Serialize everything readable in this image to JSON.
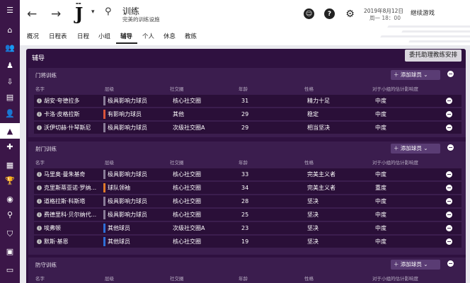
{
  "header": {
    "title": "训练",
    "subtitle": "完美的训练设施",
    "date": "2019年8月12日",
    "day_time": "周一 18：00",
    "continue_label": "继续游戏"
  },
  "tabs": [
    "概况",
    "日程表",
    "日程",
    "小组",
    "辅导",
    "个人",
    "休息",
    "教练"
  ],
  "panel": {
    "title": "辅导",
    "delegate_label": "委托助理教练安排"
  },
  "columns": [
    "名字",
    "层级",
    "社交圈",
    "年龄",
    "性格",
    "对于小组的估计影响度"
  ],
  "add_label": "添加球员",
  "sections": [
    {
      "title": "门将训练",
      "rows": [
        {
          "name": "胡安·夸德拉多",
          "level": "极具影响力球员",
          "level_color": "#8a7d99",
          "circle": "核心社交圈",
          "age": "31",
          "personality": "精力十足",
          "impact": "中度"
        },
        {
          "name": "卡洛·皮格拉斯",
          "level": "有影响力球员",
          "level_color": "#d9533b",
          "circle": "其他",
          "age": "29",
          "personality": "稳定",
          "impact": "中度"
        },
        {
          "name": "沃伊切赫·什琴斯尼",
          "level": "极具影响力球员",
          "level_color": "#8a7d99",
          "circle": "次级社交圈A",
          "age": "29",
          "personality": "相当坚决",
          "impact": "中度"
        }
      ]
    },
    {
      "title": "射门训练",
      "rows": [
        {
          "name": "马里奥·曼朱基奇",
          "level": "极具影响力球员",
          "level_color": "#8a7d99",
          "circle": "核心社交圈",
          "age": "33",
          "personality": "完美主义者",
          "impact": "中度"
        },
        {
          "name": "克里斯蒂亚诺·罗纳...",
          "level": "球队领袖",
          "level_color": "#e07a2a",
          "circle": "核心社交圈",
          "age": "34",
          "personality": "完美主义者",
          "impact": "重度"
        },
        {
          "name": "道格拉斯·科斯塔",
          "level": "极具影响力球员",
          "level_color": "#8a7d99",
          "circle": "核心社交圈",
          "age": "28",
          "personality": "坚决",
          "impact": "中度"
        },
        {
          "name": "费德里科·贝尔纳代...",
          "level": "极具影响力球员",
          "level_color": "#8a7d99",
          "circle": "核心社交圈",
          "age": "25",
          "personality": "坚决",
          "impact": "中度"
        },
        {
          "name": "埃弗顿",
          "level": "其他球员",
          "level_color": "#2f6fd6",
          "circle": "次级社交圈A",
          "age": "23",
          "personality": "坚决",
          "impact": "中度"
        },
        {
          "name": "默斯·基恩",
          "level": "其他球员",
          "level_color": "#2f6fd6",
          "circle": "核心社交圈",
          "age": "19",
          "personality": "坚决",
          "impact": "中度"
        }
      ]
    },
    {
      "title": "防守训练",
      "rows": []
    }
  ],
  "colors": {
    "sidebar": "#3b1648",
    "panel": "#2f1140",
    "section": "#3b1d4e",
    "row": "#2a0f38"
  }
}
